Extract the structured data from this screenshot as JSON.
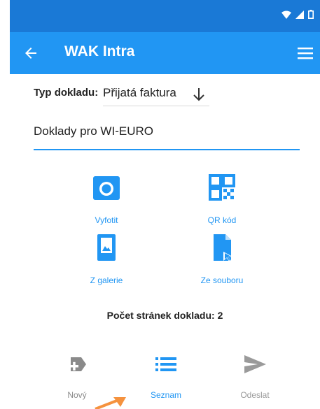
{
  "app": {
    "title": "WAK Intra"
  },
  "colors": {
    "primary": "#2196f3",
    "status_bar": "#1a79d6",
    "pointer": "#f5923e"
  },
  "icons": {
    "back": "arrow-left-icon",
    "menu": "hamburger-menu-icon",
    "status": [
      "wifi-icon",
      "signal-icon",
      "battery-icon"
    ],
    "photo": "camera-icon",
    "qr": "qr-code-icon",
    "gallery": "image-icon",
    "file": "file-icon",
    "new": "add-document-icon",
    "list": "list-icon",
    "send": "send-icon"
  },
  "doc_type": {
    "label": "Typ dokladu:",
    "value": "Přijatá faktura"
  },
  "doc_field": {
    "value": "Doklady pro WI-EURO"
  },
  "actions": {
    "photo": "Vyfotit",
    "qr": "QR kód",
    "gallery": "Z galerie",
    "file": "Ze souboru"
  },
  "page_count": "Počet stránek dokladu: 2",
  "bottom_nav": {
    "new": "Nový",
    "list": "Seznam",
    "send": "Odeslat"
  }
}
